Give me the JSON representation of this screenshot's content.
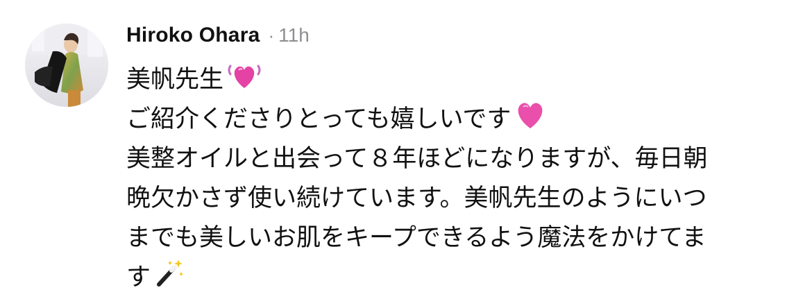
{
  "comment": {
    "author": "Hiroko Ohara",
    "separator": "·",
    "timestamp": "11h",
    "avatar_icon": "profile-photo",
    "lines": [
      "美帆先生",
      "ご紹介くださりとっても嬉しいです",
      "美整オイルと出会って８年ほどになりますが、毎日朝",
      "晩欠かさず使い続けています。美帆先生のようにいつ",
      "までも美しいお肌をキープできるよう魔法をかけてま",
      "す"
    ],
    "emojis": [
      "beating-heart-icon",
      "pink-heart-icon",
      "magic-wand-icon"
    ]
  }
}
